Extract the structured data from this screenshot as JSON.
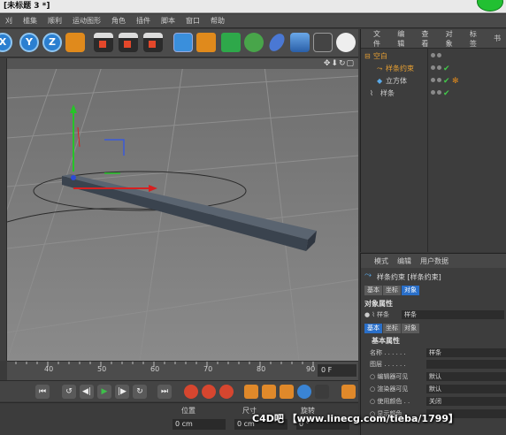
{
  "window": {
    "title": "[未标题 3 *]"
  },
  "menubar": {
    "items": [
      "刈",
      "槛集",
      "顺利",
      "运动图形",
      "角色",
      "插件",
      "脚本",
      "窗口",
      "帮助"
    ]
  },
  "toolbar": {
    "axis_x": "X",
    "axis_y": "Y",
    "axis_z": "Z",
    "icons": [
      "coordinate-system-icon",
      "render-view-icon",
      "render-picture-queue-icon",
      "render-settings-icon",
      "cube-icon",
      "spline-icon",
      "generator-icon",
      "mograph-cloner-icon",
      "deformer-icon",
      "floor-icon",
      "camera-icon",
      "light-bulb-icon"
    ]
  },
  "viewport": {
    "nav_icons": "✥⬇↻▢"
  },
  "timeline": {
    "ticks": [
      "40",
      "50",
      "60",
      "70",
      "80",
      "90"
    ],
    "frame": "0 F"
  },
  "transport": {
    "buttons": [
      "⏮",
      "↺",
      "◀|",
      "▶",
      "|▶",
      "↻",
      "⏭"
    ]
  },
  "coords": {
    "position": "位置",
    "size": "尺寸",
    "rotation": "旋转",
    "pos_x": "0 cm",
    "size_x": "0 cm",
    "rot_h": "0 °"
  },
  "object_manager": {
    "menu": [
      "文件",
      "编辑",
      "查看",
      "对象",
      "标签",
      "书"
    ],
    "objects": [
      {
        "name": "空白",
        "color": "#e8a032"
      },
      {
        "name": "样条约束",
        "color": "#e8a032"
      },
      {
        "name": "立方体",
        "color": "#d0d0d0"
      },
      {
        "name": "样条",
        "color": "#d0d0d0"
      }
    ]
  },
  "attributes": {
    "menu": [
      "模式",
      "编辑",
      "用户数据"
    ],
    "title": "样条约束 [样条约束]",
    "tabs_top": [
      "基本",
      "坐标",
      "对象"
    ],
    "section_object": "对象属性",
    "spline_label": "样条",
    "spline_value": "样条",
    "tabs_sub": [
      "基本",
      "坐标",
      "对象"
    ],
    "section_basic": "基本属性",
    "fields": [
      {
        "label": "名称 . . . . . .",
        "value": "样条"
      },
      {
        "label": "图层 . . . . . .",
        "value": ""
      },
      {
        "label": "编辑器可见",
        "value": "默认"
      },
      {
        "label": "渲染器可见",
        "value": "默认"
      },
      {
        "label": "使用颜色 . .",
        "value": "关闭"
      },
      {
        "label": "显示颜色",
        "value": ""
      }
    ]
  },
  "watermark": "C4D吧 【www.linecg.com/tieba/1799】"
}
